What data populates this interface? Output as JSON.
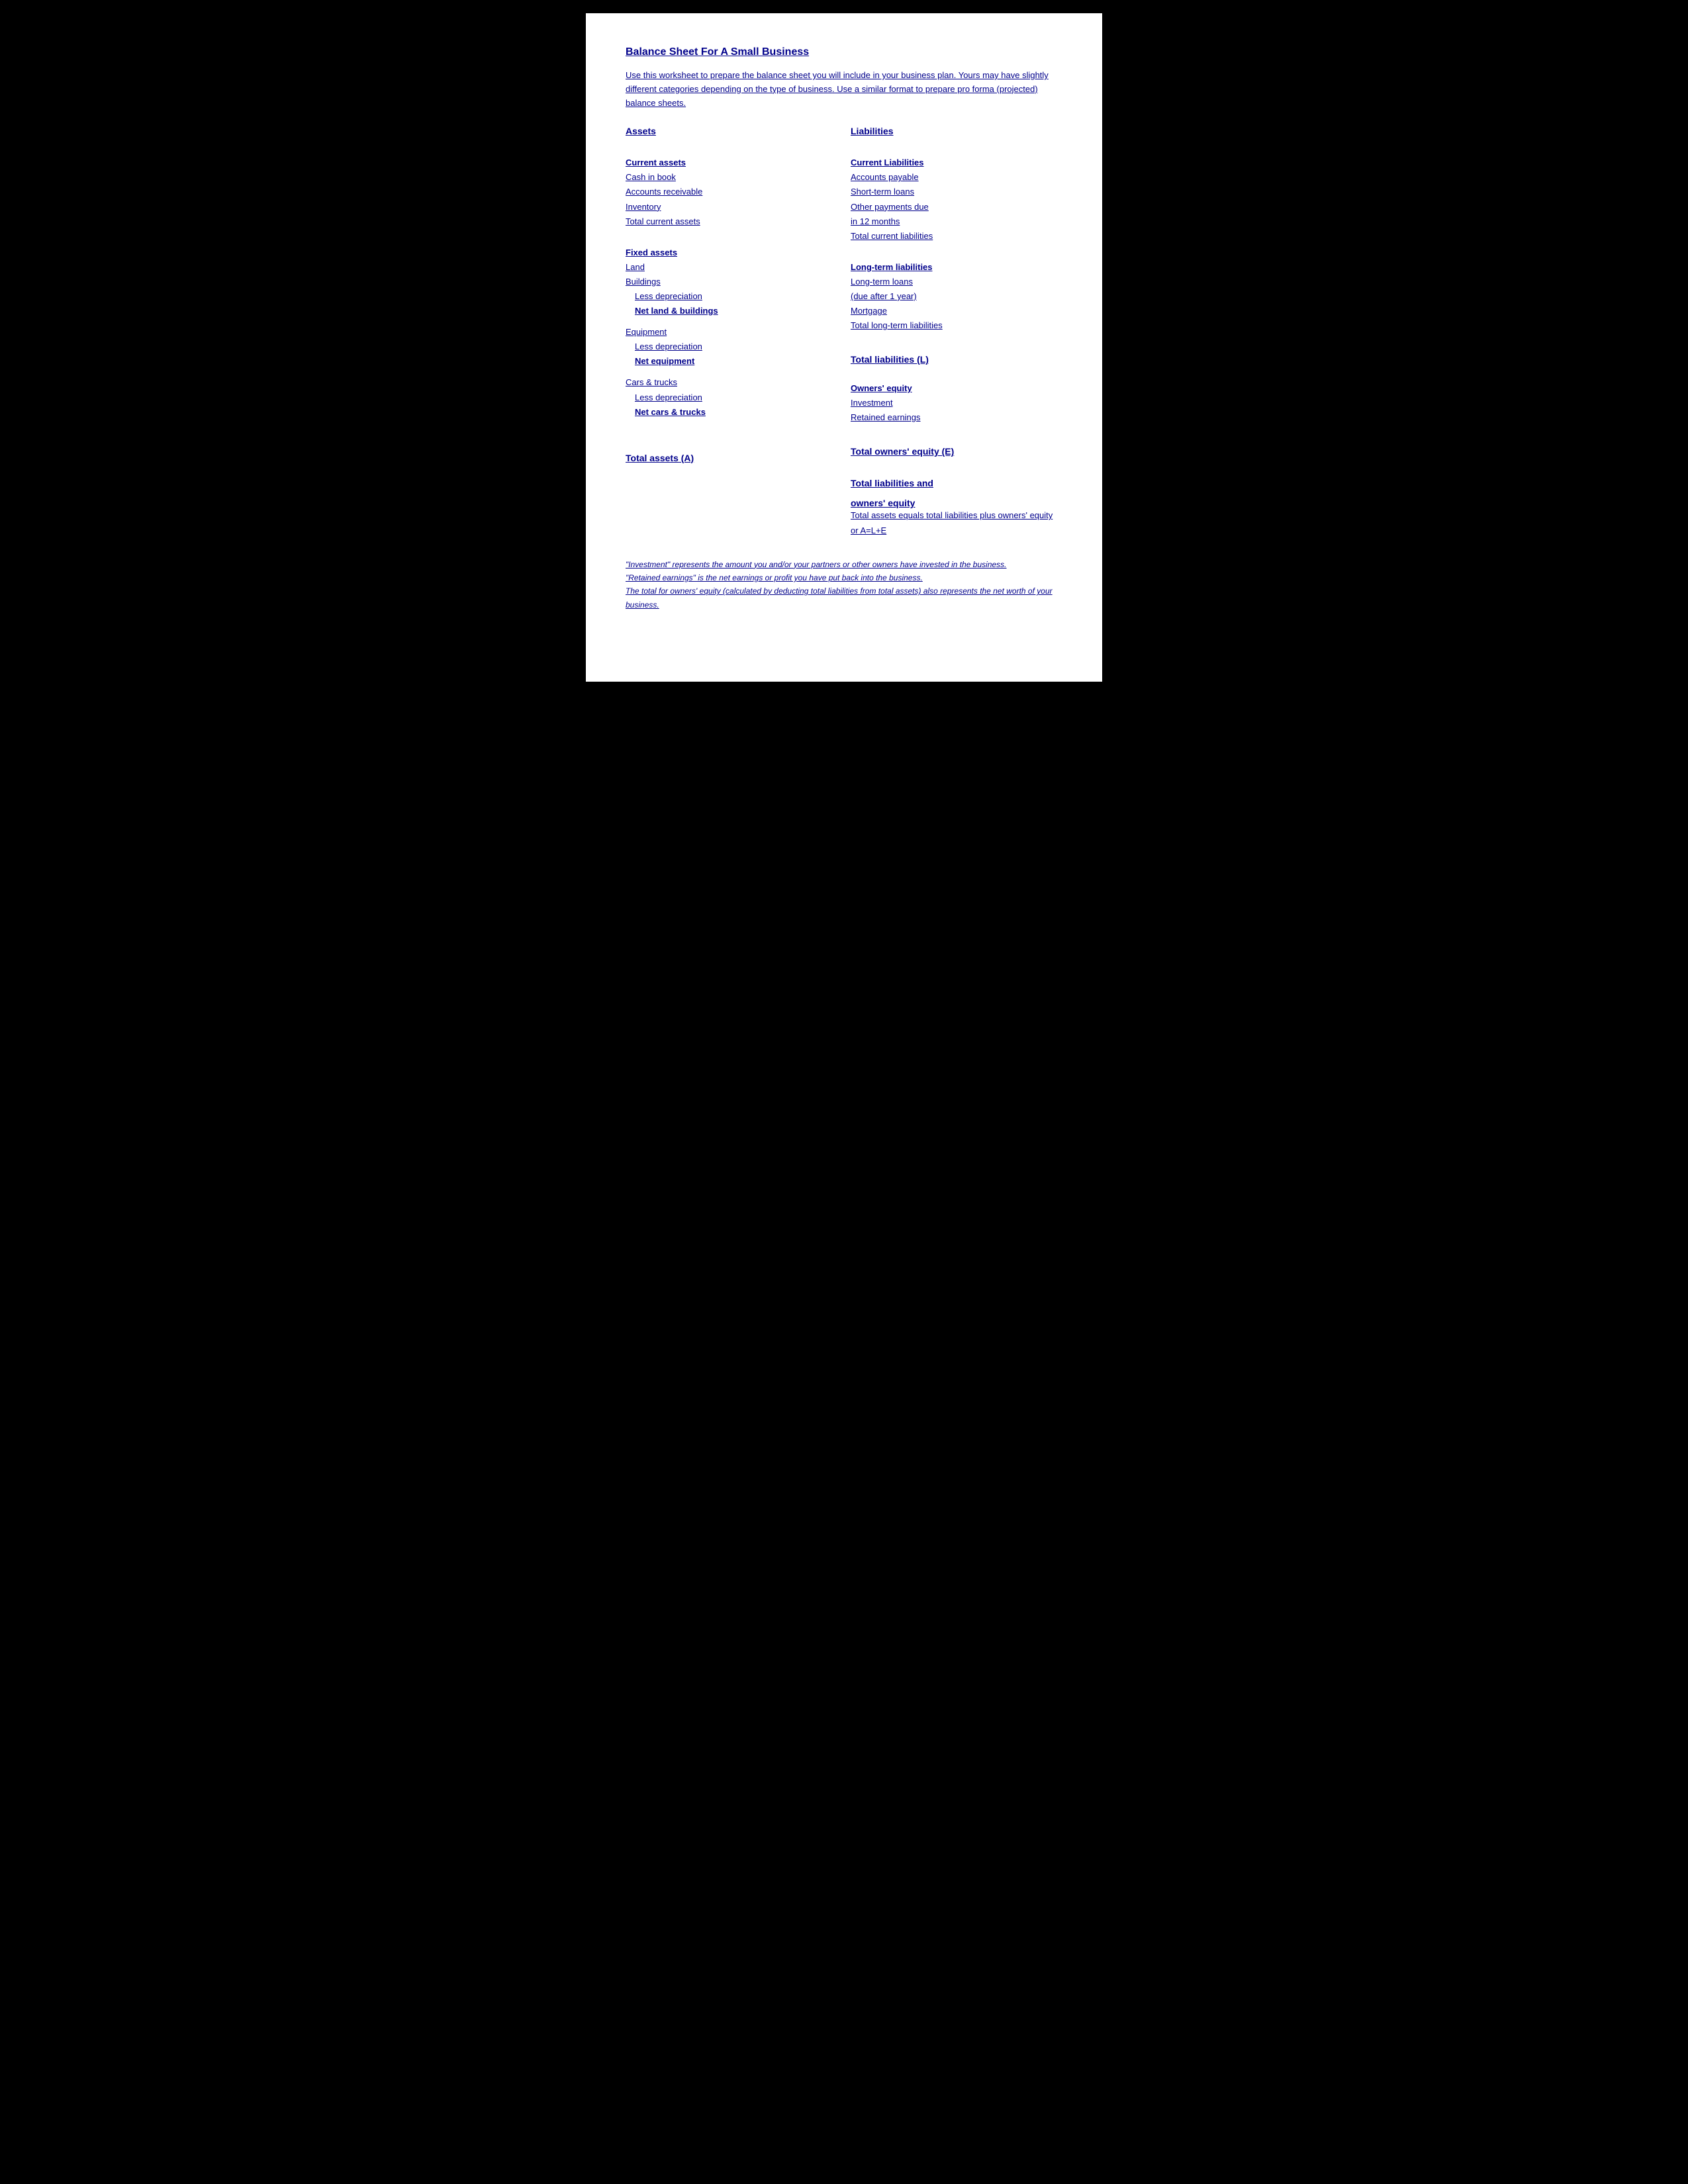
{
  "page": {
    "title": "Balance Sheet For A Small Business",
    "intro": "Use this worksheet to prepare the balance sheet you will include in your business plan.  Yours may have slightly different categories depending on the type of business.  Use a similar format to prepare pro forma (projected) balance sheets.",
    "assets": {
      "header": "Assets",
      "current_assets": {
        "header": "Current assets",
        "items": [
          "Cash in book",
          "Accounts receivable",
          "Inventory",
          "Total current assets"
        ]
      },
      "fixed_assets": {
        "header": "Fixed assets",
        "land": "Land",
        "buildings": "Buildings",
        "less_dep_buildings": "Less depreciation",
        "net_land": "Net land & buildings",
        "equipment_header": "Equipment",
        "less_dep_equipment": "Less depreciation",
        "net_equipment": "Net equipment",
        "cars_header": "Cars & trucks",
        "less_dep_cars": "Less depreciation",
        "net_cars": "Net cars & trucks"
      },
      "total": "Total assets (A)"
    },
    "liabilities": {
      "header": "Liabilities",
      "current_liabilities": {
        "header": "Current Liabilities",
        "items": [
          "Accounts payable",
          "Short-term loans",
          "Other payments due",
          " in 12 months",
          "Total current liabilities"
        ]
      },
      "long_term": {
        "header": "Long-term liabilities",
        "items": [
          "Long-term loans",
          " (due after 1 year)",
          "Mortgage",
          "Total long-term liabilities"
        ]
      },
      "total_liabilities": "Total liabilities (L)",
      "owners_equity": {
        "header": "Owners' equity",
        "items": [
          "Investment",
          "Retained earnings"
        ]
      },
      "total_equity": "Total owners' equity (E)",
      "total_liabilities_equity": {
        "header": "Total liabilities and",
        "header2": " owners' equity",
        "description": "Total assets equals total liabilities plus owners' equity or A=L+E"
      }
    },
    "footnotes": [
      "\"Investment\" represents the amount you and/or your partners or other owners have invested in the business.",
      " \"Retained earnings\" is the net earnings or profit you have put back into the business.",
      "The total for owners' equity (calculated by deducting total liabilities from total assets) also represents the net worth of your business."
    ]
  }
}
